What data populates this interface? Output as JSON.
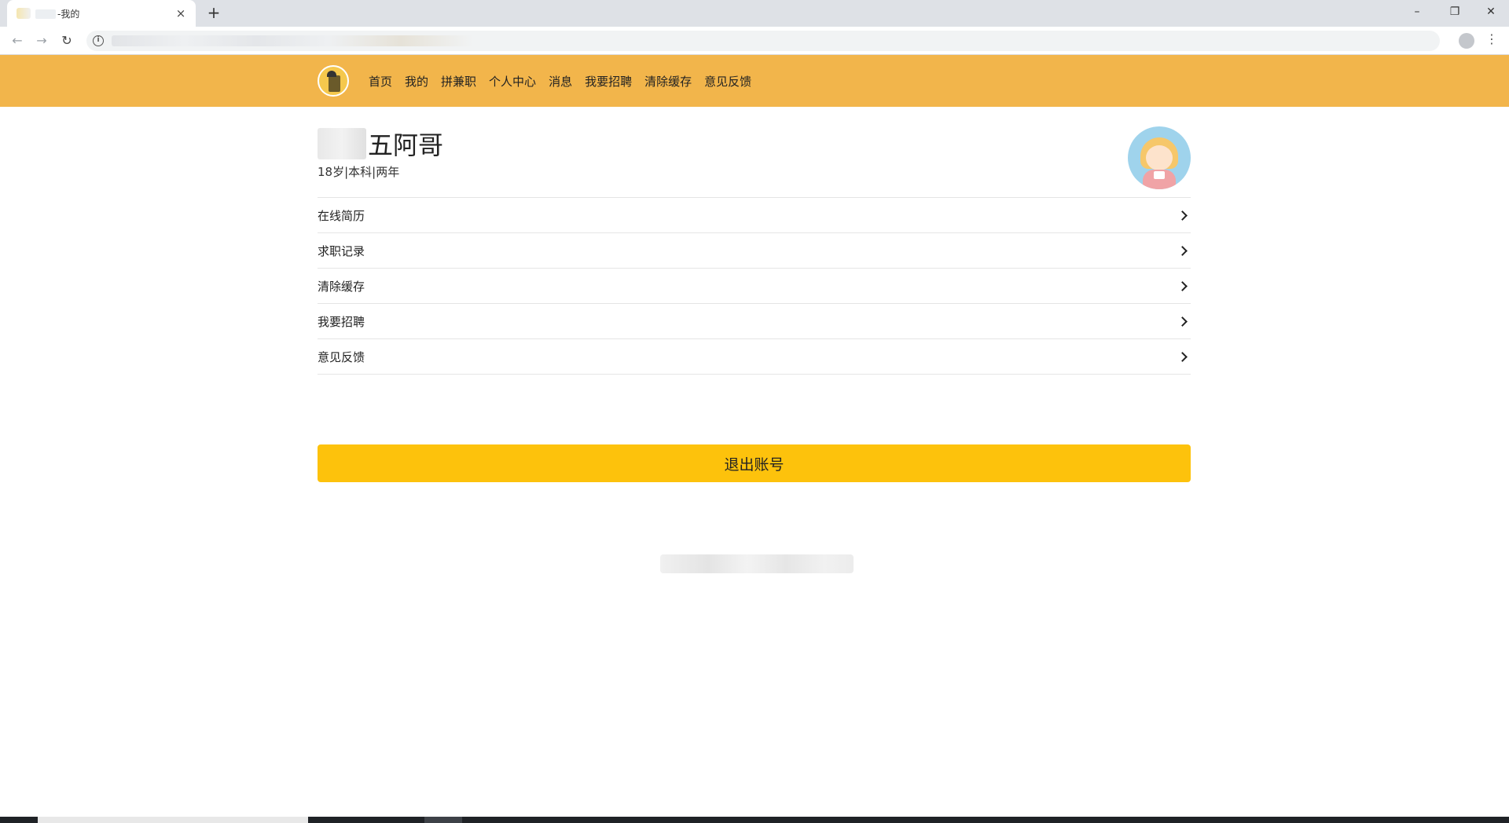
{
  "browser": {
    "tab_title": "-我的",
    "new_tab_label": "+",
    "close_tab_label": "×",
    "window_controls": {
      "minimize": "–",
      "maximize": "❐",
      "close": "✕"
    },
    "nav": {
      "back": "←",
      "forward": "→",
      "reload": "↻"
    },
    "info_icon": "i",
    "star_icon": "☆",
    "menu_icon": "⋮"
  },
  "header": {
    "nav_items": [
      "首页",
      "我的",
      "拼兼职",
      "个人中心",
      "消息",
      "我要招聘",
      "清除缓存",
      "意见反馈"
    ],
    "accent_color": "#f2b54b"
  },
  "profile": {
    "name": "五阿哥",
    "meta": "18岁|本科|两年"
  },
  "menu": [
    {
      "label": "在线简历"
    },
    {
      "label": "求职记录"
    },
    {
      "label": "清除缓存"
    },
    {
      "label": "我要招聘"
    },
    {
      "label": "意见反馈"
    }
  ],
  "logout": {
    "label": "退出账号",
    "color": "#fdc20c"
  }
}
